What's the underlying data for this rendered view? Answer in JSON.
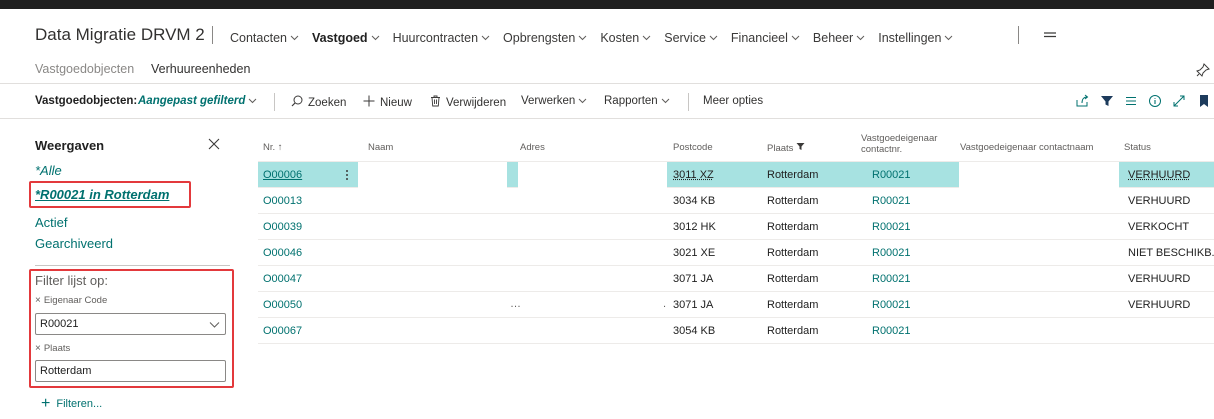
{
  "app": {
    "title": "Data Migratie DRVM 2"
  },
  "nav": {
    "items": [
      {
        "label": "Contacten",
        "active": false
      },
      {
        "label": "Vastgoed",
        "active": true
      },
      {
        "label": "Huurcontracten",
        "active": false
      },
      {
        "label": "Opbrengsten",
        "active": false
      },
      {
        "label": "Kosten",
        "active": false
      },
      {
        "label": "Service",
        "active": false
      },
      {
        "label": "Financieel",
        "active": false
      },
      {
        "label": "Beheer",
        "active": false
      },
      {
        "label": "Instellingen",
        "active": false
      }
    ],
    "menu_icon": "hamburger-icon"
  },
  "subnav": {
    "items": [
      "Vastgoedobjecten",
      "Verhuureenheden"
    ],
    "pin_icon": "pin-icon"
  },
  "actionbar": {
    "page_label": "Vastgoedobjecten:",
    "filter_label": "Aangepast gefilterd",
    "search": "Zoeken",
    "new": "Nieuw",
    "delete": "Verwijderen",
    "process": "Verwerken",
    "reports": "Rapporten",
    "more": "Meer opties",
    "right_icons": [
      "share-icon",
      "filter-icon",
      "list-icon",
      "info-icon",
      "expand-icon",
      "bookmark-icon"
    ]
  },
  "views": {
    "title": "Weergaven",
    "items": [
      {
        "label": "*Alle",
        "style": "italic"
      },
      {
        "label": "*R00021 in Rotterdam",
        "style": "selected"
      },
      {
        "label": "Actief",
        "style": "normal"
      },
      {
        "label": "Gearchiveerd",
        "style": "normal"
      }
    ]
  },
  "filters": {
    "title": "Filter lijst op:",
    "fields": [
      {
        "label": "Eigenaar Code",
        "value": "R00021"
      },
      {
        "label": "Plaats",
        "value": "Rotterdam"
      }
    ],
    "add_label": "Filteren..."
  },
  "table": {
    "columns": {
      "nr": "Nr. ↑",
      "naam": "Naam",
      "adres": "Adres",
      "postcode": "Postcode",
      "plaats": "Plaats",
      "owner_no_line1": "Vastgoedeigenaar",
      "owner_no_line2": "contactnr.",
      "owner_name": "Vastgoedeigenaar contactnaam",
      "status": "Status"
    },
    "rows": [
      {
        "nr": "O00006",
        "postcode": "3011 XZ",
        "plaats": "Rotterdam",
        "owner": "R00021",
        "status": "VERHUURD"
      },
      {
        "nr": "O00013",
        "postcode": "3034 KB",
        "plaats": "Rotterdam",
        "owner": "R00021",
        "status": "VERHUURD"
      },
      {
        "nr": "O00039",
        "postcode": "3012 HK",
        "plaats": "Rotterdam",
        "owner": "R00021",
        "status": "VERKOCHT"
      },
      {
        "nr": "O00046",
        "postcode": "3021 XE",
        "plaats": "Rotterdam",
        "owner": "R00021",
        "status": "NIET BESCHIKB..."
      },
      {
        "nr": "O00047",
        "postcode": "3071 JA",
        "plaats": "Rotterdam",
        "owner": "R00021",
        "status": "VERHUURD"
      },
      {
        "nr": "O00050",
        "postcode": "3071 JA",
        "plaats": "Rotterdam",
        "owner": "R00021",
        "status": "VERHUURD"
      },
      {
        "nr": "O00067",
        "postcode": "3054 KB",
        "plaats": "Rotterdam",
        "owner": "R00021",
        "status": ""
      }
    ]
  },
  "colors": {
    "accent": "#00716f",
    "selected_row": "#a7e2e1",
    "highlight_box": "#e3393c"
  }
}
